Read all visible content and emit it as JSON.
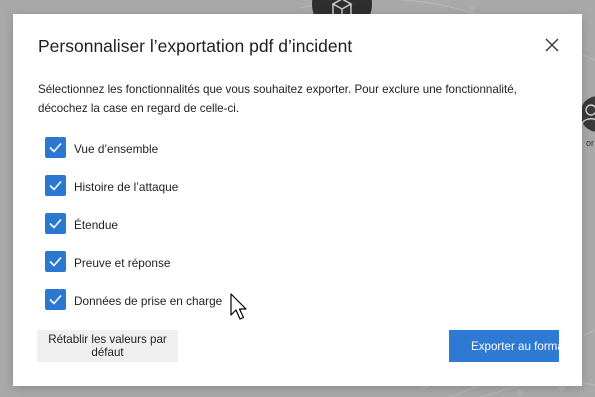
{
  "dialog": {
    "title": "Personnaliser l’exportation pdf d’incident",
    "description": "Sélectionnez les fonctionnalités que vous souhaitez exporter. Pour exclure une fonctionnalité, décochez la case en regard de celle-ci.",
    "options": [
      {
        "label": "Vue d’ensemble",
        "checked": true
      },
      {
        "label": "Histoire de l’attaque",
        "checked": true
      },
      {
        "label": "Étendue",
        "checked": true
      },
      {
        "label": "Preuve et réponse",
        "checked": true
      },
      {
        "label": "Données de prise en charge",
        "checked": true
      }
    ],
    "reset_label": "Rétablir les valeurs par défaut",
    "export_label": "Exporter au format"
  },
  "background": {
    "side_label": "or"
  },
  "colors": {
    "accent": "#2d79d4",
    "checkbox": "#2a78d2",
    "overlay": "#a9a9a9"
  },
  "icons": {
    "close": "close-icon",
    "check": "checkmark-icon",
    "cursor": "mouse-pointer-icon",
    "background_node": "cube-icon",
    "background_avatar": "person-icon"
  }
}
